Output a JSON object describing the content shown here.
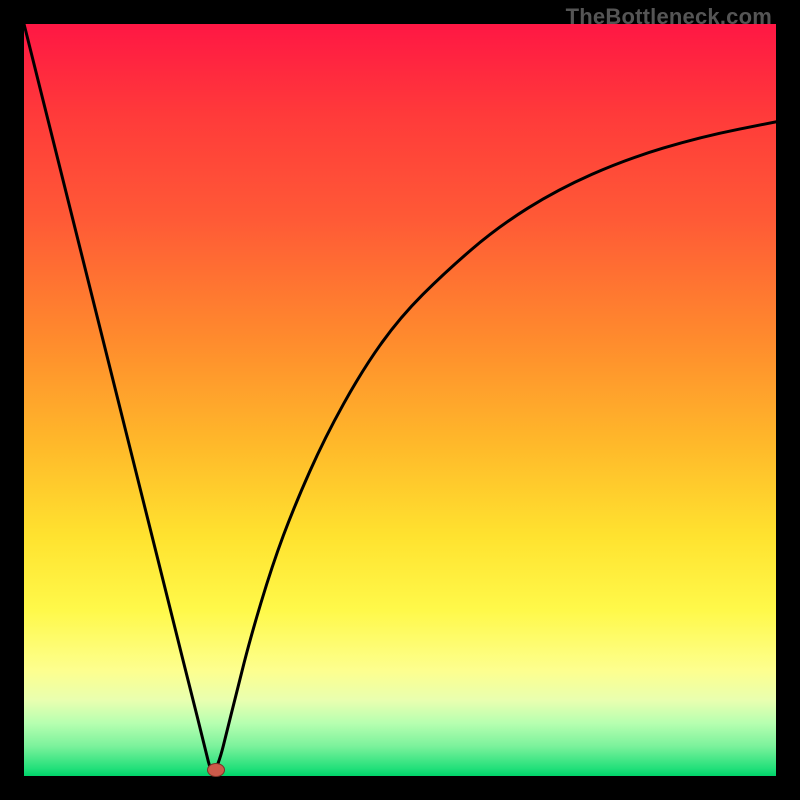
{
  "watermark": "TheBottleneck.com",
  "marker": {
    "x_pct": 25.5,
    "y_pct": 99.2
  },
  "chart_data": {
    "type": "line",
    "title": "",
    "xlabel": "",
    "ylabel": "",
    "xlim": [
      0,
      100
    ],
    "ylim": [
      0,
      100
    ],
    "grid": false,
    "legend": false,
    "annotations": [
      "TheBottleneck.com"
    ],
    "series": [
      {
        "name": "bottleneck-curve",
        "x": [
          0,
          5,
          10,
          15,
          20,
          22,
          24,
          25,
          26,
          27,
          28,
          30,
          33,
          36,
          40,
          45,
          50,
          56,
          63,
          71,
          80,
          90,
          100
        ],
        "y": [
          100,
          80,
          60,
          40,
          20,
          12,
          4,
          0,
          2,
          6,
          10,
          18,
          28,
          36,
          45,
          54,
          61,
          67,
          73,
          78,
          82,
          85,
          87
        ]
      }
    ],
    "gradient_stops_top_to_bottom": [
      {
        "pct": 0,
        "color": "#ff1744"
      },
      {
        "pct": 26,
        "color": "#ff5a36"
      },
      {
        "pct": 56,
        "color": "#ffb92a"
      },
      {
        "pct": 78,
        "color": "#fff94a"
      },
      {
        "pct": 93,
        "color": "#b6ffb0"
      },
      {
        "pct": 100,
        "color": "#00d36a"
      }
    ],
    "marker_point": {
      "x": 25.5,
      "y": 0.8
    }
  }
}
